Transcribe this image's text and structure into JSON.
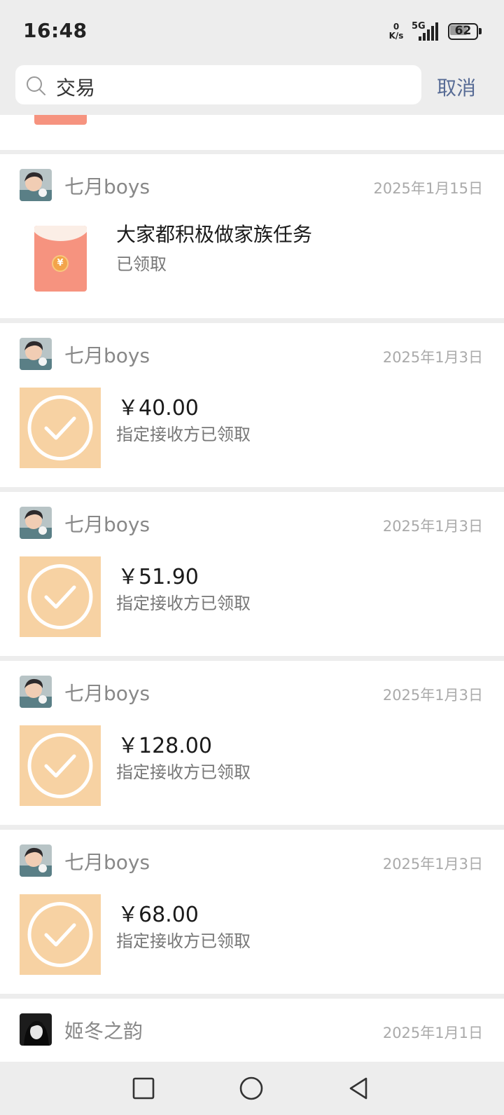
{
  "status_bar": {
    "time": "16:48",
    "net_speed_value": "0",
    "net_speed_unit": "K/s",
    "network": "5G",
    "battery": "62"
  },
  "search": {
    "value": "交易",
    "cancel_label": "取消"
  },
  "items": [
    {
      "sender": "七月boys",
      "date": "2025年1月15日",
      "type": "red-packet",
      "title": "大家都积极做家族任务",
      "status": "已领取"
    },
    {
      "sender": "七月boys",
      "date": "2025年1月3日",
      "type": "transfer",
      "amount": "￥40.00",
      "status": "指定接收方已领取"
    },
    {
      "sender": "七月boys",
      "date": "2025年1月3日",
      "type": "transfer",
      "amount": "￥51.90",
      "status": "指定接收方已领取"
    },
    {
      "sender": "七月boys",
      "date": "2025年1月3日",
      "type": "transfer",
      "amount": "￥128.00",
      "status": "指定接收方已领取"
    },
    {
      "sender": "七月boys",
      "date": "2025年1月3日",
      "type": "transfer",
      "amount": "￥68.00",
      "status": "指定接收方已领取"
    },
    {
      "sender": "姬冬之韵",
      "date": "2025年1月1日",
      "type": "partial"
    }
  ],
  "colors": {
    "accent": "#576b95",
    "transfer_thumb": "#f7d2a3",
    "red_packet": "#f6937f",
    "background": "#ededed"
  },
  "nav": {
    "icons": [
      "recents-square-icon",
      "home-circle-icon",
      "back-triangle-icon"
    ]
  }
}
